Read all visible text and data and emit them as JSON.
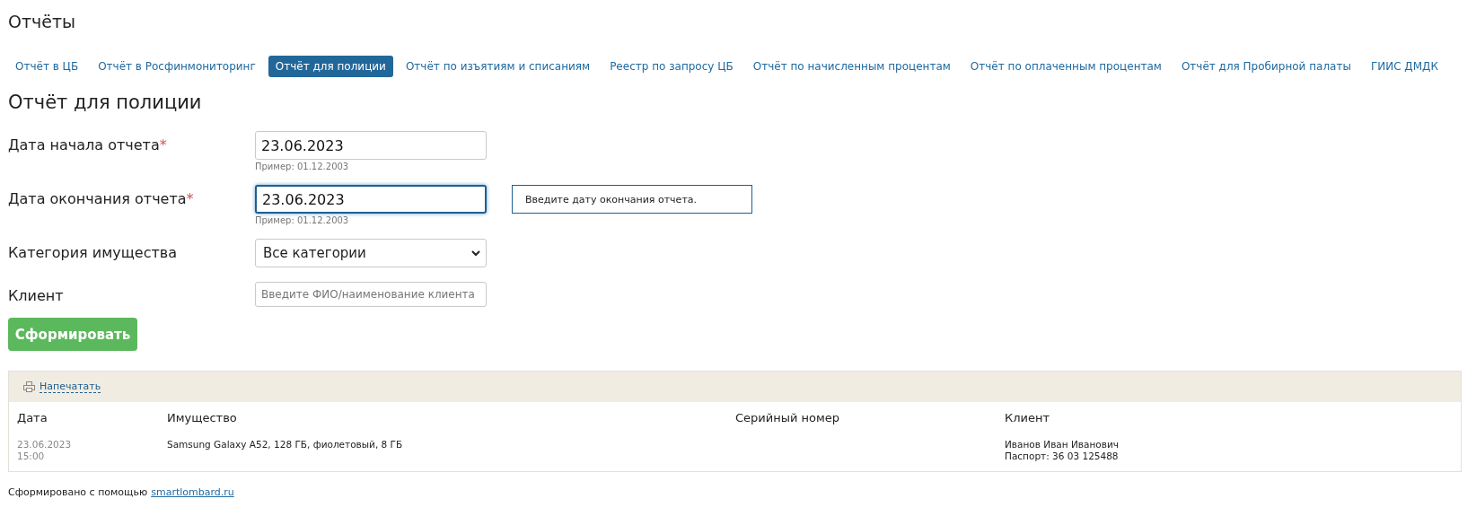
{
  "page_title": "Отчёты",
  "tabs": [
    {
      "label": "Отчёт в ЦБ",
      "selected": false
    },
    {
      "label": "Отчёт в Росфинмониторинг",
      "selected": false
    },
    {
      "label": "Отчёт для полиции",
      "selected": true
    },
    {
      "label": "Отчёт по изъятиям и списаниям",
      "selected": false
    },
    {
      "label": "Реестр по запросу ЦБ",
      "selected": false
    },
    {
      "label": "Отчёт по начисленным процентам",
      "selected": false
    },
    {
      "label": "Отчёт по оплаченным процентам",
      "selected": false
    },
    {
      "label": "Отчёт для Пробирной палаты",
      "selected": false
    },
    {
      "label": "ГИИС ДМДК",
      "selected": false
    }
  ],
  "section_title": "Отчёт для полиции",
  "form": {
    "fields": [
      {
        "kind": "date",
        "label": "Дата начала отчета",
        "required_mark": "*",
        "value": "23.06.2023",
        "hint": "Пример: 01.12.2003"
      },
      {
        "kind": "date",
        "label": "Дата окончания отчета",
        "required_mark": "*",
        "value": "23.06.2023",
        "hint": "Пример: 01.12.2003",
        "focused": true,
        "tooltip": "Введите дату окончания отчета."
      },
      {
        "kind": "select",
        "label": "Категория имущества",
        "value": "Все категории"
      },
      {
        "kind": "text",
        "label": "Клиент",
        "placeholder": "Введите ФИО/наименование клиента"
      }
    ],
    "submit": "Сформировать"
  },
  "report": {
    "print_link": "Напечатать",
    "columns": [
      "Дата",
      "Имущество",
      "Серийный номер",
      "Клиент"
    ],
    "rows": [
      {
        "cells": [
          [
            "23.06.2023",
            "15:00"
          ],
          [
            "Samsung Galaxy A52, 128 ГБ, фиолетовый, 8 ГБ"
          ],
          [],
          [
            "Иванов Иван Иванович",
            "Паспорт: 36 03 125488"
          ]
        ]
      }
    ]
  },
  "footer": {
    "text": "Сформировано с помощью",
    "link": "smartlombard.ru"
  }
}
